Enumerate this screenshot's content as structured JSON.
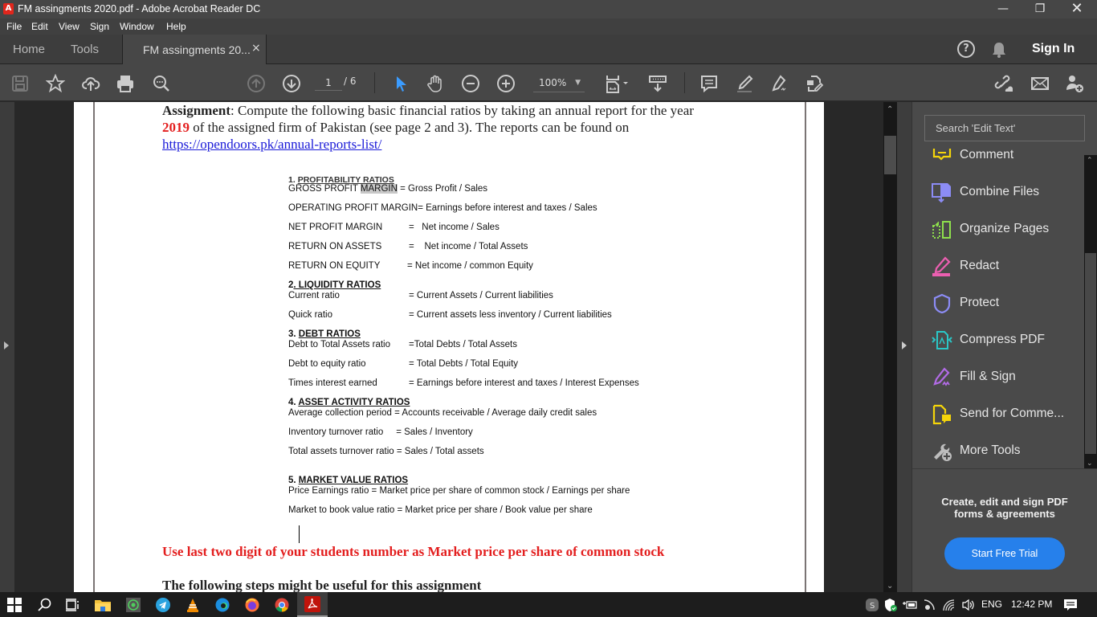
{
  "window": {
    "title": "FM assingments 2020.pdf - Adobe Acrobat Reader DC",
    "controls": [
      "minimize",
      "restore",
      "close"
    ]
  },
  "menu": [
    "File",
    "Edit",
    "View",
    "Sign",
    "Window",
    "Help"
  ],
  "tabs": {
    "home": "Home",
    "tools": "Tools",
    "document": "FM assingments 20...",
    "close": "×",
    "sign_in": "Sign In"
  },
  "toolbar": {
    "page_current": "1",
    "page_total": "/ 6",
    "zoom": "100%"
  },
  "document": {
    "intro_bold": "Assignment",
    "intro_1": ": Compute the following basic financial ratios by taking an annual report for the year",
    "intro_year": "2019",
    "intro_2": " of the assigned firm of Pakistan (see page 2 and 3). The reports can be found on",
    "link": "https://opendoors.pk/annual-reports-list/",
    "sections": [
      {
        "num": "1. ",
        "title": "PROFITABILITY RATIOS",
        "rows": [
          {
            "pre": "GROSS PROFIT ",
            "hl": "MARGIN",
            "post": " = Gross Profit / Sales"
          },
          {
            "pre": "OPERATING PROFIT MARGIN= Earnings before interest and taxes / Sales"
          },
          {
            "label": "NET PROFIT MARGIN",
            "formula": "=   Net income / Sales"
          },
          {
            "label": "RETURN ON ASSETS",
            "formula": "=    Net income / Total Assets"
          },
          {
            "label": "RETURN ON EQUITY",
            "formula": "= Net income / common Equity"
          }
        ]
      },
      {
        "num": "2",
        "title": ". LIQUIDITY RATIOS",
        "rows": [
          {
            "label": "Current ratio",
            "formula": "= Current Assets / Current liabilities"
          },
          {
            "label": "Quick ratio",
            "formula": "= Current assets less inventory / Current liabilities"
          }
        ]
      },
      {
        "num": "3. ",
        "title": "DEBT RATIOS",
        "rows": [
          {
            "label": "Debt to Total Assets ratio",
            "formula": "=Total Debts / Total Assets"
          },
          {
            "label": "Debt to equity ratio",
            "formula": "= Total Debts / Total Equity"
          },
          {
            "label": "Times interest earned",
            "formula": "= Earnings before interest and taxes / Interest Expenses"
          }
        ]
      },
      {
        "num": "4. ",
        "title": "ASSET ACTIVITY RATIOS",
        "rows": [
          {
            "pre": "Average collection period = Accounts receivable / Average daily credit sales"
          },
          {
            "pre": "Inventory turnover ratio     = Sales / Inventory"
          },
          {
            "pre": "Total assets turnover ratio = Sales / Total assets"
          }
        ]
      },
      {
        "num": "5. ",
        "title": "MARKET VALUE RATIOS",
        "rows": [
          {
            "pre": "Price Earnings ratio = Market price per share of common stock / Earnings per share"
          },
          {
            "pre": "Market to book value ratio = Market price per share / Book value per share"
          }
        ]
      }
    ],
    "note_red": "Use last two digit of your students number as Market price per share of common stock",
    "steps_heading": "The following steps might be useful for this assignment"
  },
  "tools_pane": {
    "search_placeholder": "Search 'Edit Text'",
    "items": [
      {
        "label": "Comment",
        "color": "#f5d50a"
      },
      {
        "label": "Combine Files",
        "color": "#8c8cf5"
      },
      {
        "label": "Organize Pages",
        "color": "#8ee04c"
      },
      {
        "label": "Redact",
        "color": "#ec5fb1"
      },
      {
        "label": "Protect",
        "color": "#8c8cf5"
      },
      {
        "label": "Compress PDF",
        "color": "#2ac7c7"
      },
      {
        "label": "Fill & Sign",
        "color": "#b26be6"
      },
      {
        "label": "Send for Comme...",
        "color": "#f5d50a"
      },
      {
        "label": "More Tools",
        "color": "#bdbdbd"
      }
    ],
    "promo": "Create, edit and sign PDF forms & agreements",
    "promo_line1": "Create, edit and sign PDF",
    "promo_line2": "forms & agreements",
    "trial_button": "Start Free Trial",
    "accent": "#2680eb"
  },
  "taskbar": {
    "apps": [
      "start",
      "search",
      "task-view",
      "file-explorer",
      "whatsapp",
      "telegram",
      "vlc",
      "edge",
      "firefox",
      "chrome",
      "acrobat"
    ],
    "language": "ENG",
    "time": "12:42 PM"
  }
}
